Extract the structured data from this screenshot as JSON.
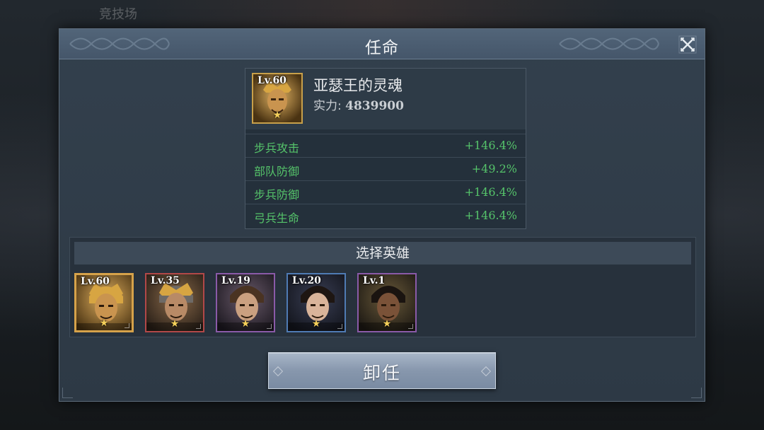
{
  "background": {
    "title": "竞技场"
  },
  "dialog": {
    "title": "任命",
    "close_icon": "close-icon"
  },
  "hero_info": {
    "level": "Lv.60",
    "name": "亚瑟王的灵魂",
    "power_label": "实力:",
    "power_value": "4839900",
    "stats": [
      {
        "label": "步兵攻击",
        "value": "+146.4%"
      },
      {
        "label": "部队防御",
        "value": "+49.2%"
      },
      {
        "label": "步兵防御",
        "value": "+146.4%"
      },
      {
        "label": "弓兵生命",
        "value": "+146.4%"
      }
    ]
  },
  "select_heroes": {
    "title": "选择英雄",
    "heroes": [
      {
        "level": "Lv.60",
        "star": "★",
        "frame_color": "#d6a24a",
        "selected": true
      },
      {
        "level": "Lv.35",
        "star": "★",
        "frame_color": "#b24848",
        "selected": false
      },
      {
        "level": "Lv.19",
        "star": "★",
        "frame_color": "#8a5aa8",
        "selected": false
      },
      {
        "level": "Lv.20",
        "star": "★",
        "frame_color": "#4f7bb4",
        "selected": false
      },
      {
        "level": "Lv.1",
        "star": "★",
        "frame_color": "#8a5aa8",
        "selected": false
      }
    ]
  },
  "dismiss_button": {
    "label": "卸任"
  },
  "colors": {
    "stat_green": "#55c36a",
    "dialog_bg": "#33404d",
    "title_bar": "#526579"
  }
}
